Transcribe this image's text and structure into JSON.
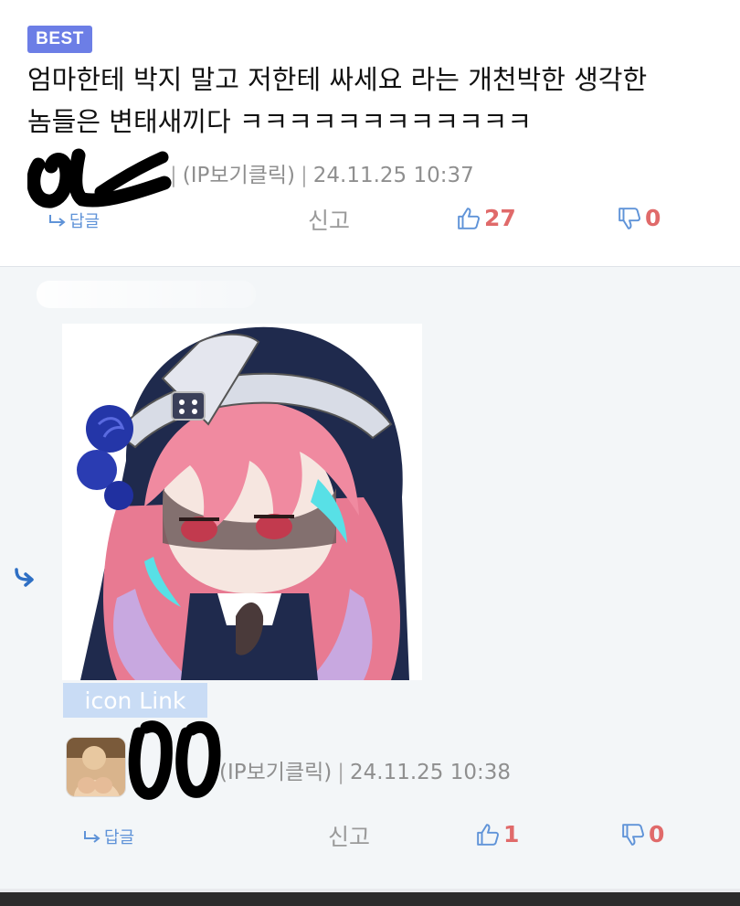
{
  "comment1": {
    "badge": "BEST",
    "text_line1": "엄마한테 박지 말고 저한테 싸세요 라는 개천박한 생각한",
    "text_line2": "놈들은 변태새끼다 ㅋㅋㅋㅋㅋㅋㅋㅋㅋㅋㅋㅋ",
    "author_scribble": "ㅇㄴ",
    "ip_label": "(IP보기클릭)",
    "timestamp": "24.11.25 10:37",
    "reply_label": "답글",
    "report_label": "신고",
    "upvotes": "27",
    "downvotes": "0"
  },
  "comment2": {
    "icon_link_label": "icon Link",
    "author_scribble": "00",
    "ip_label": "(IP보기클릭)",
    "timestamp": "24.11.25 10:38",
    "reply_label": "답글",
    "report_label": "신고",
    "upvotes": "1",
    "downvotes": "0"
  },
  "colors": {
    "badge_bg": "#6c7ee6",
    "vote_number": "#e06a6a",
    "reply_link": "#5f93d8",
    "icon_link_bg": "#c9dcf5",
    "reply_section_bg": "#f3f6f8"
  },
  "icons": {
    "reply": "reply-arrow-icon",
    "upvote": "thumbs-up-icon",
    "downvote": "thumbs-down-icon"
  }
}
